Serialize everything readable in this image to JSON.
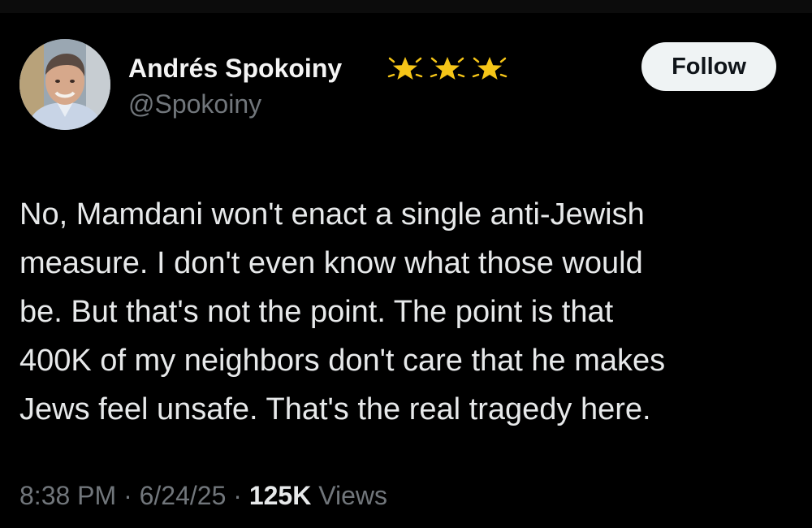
{
  "author": {
    "display_name": "Andrés Spokoiny",
    "handle": "@Spokoiny",
    "avatar": "profile-photo",
    "badges": [
      "glowing-star-icon",
      "glowing-star-icon",
      "glowing-star-icon"
    ]
  },
  "actions": {
    "follow_label": "Follow"
  },
  "tweet": {
    "text_lines": [
      "No, Mamdani won't enact a single anti-Jewish",
      "measure. I don't even know what those would",
      "be. But that's not the point. The point is that",
      "400K of my neighbors don't care that he makes",
      "Jews feel unsafe. That's the real tragedy here."
    ]
  },
  "meta": {
    "time": "8:38 PM",
    "separator": "·",
    "date": "6/24/25",
    "views_count": "125K",
    "views_label": "Views"
  },
  "colors": {
    "background": "#000000",
    "text": "#e7e9ea",
    "secondary_text": "#71767b",
    "follow_button_bg": "#eff3f4",
    "follow_button_text": "#0f1419",
    "star": "#f5c518"
  }
}
